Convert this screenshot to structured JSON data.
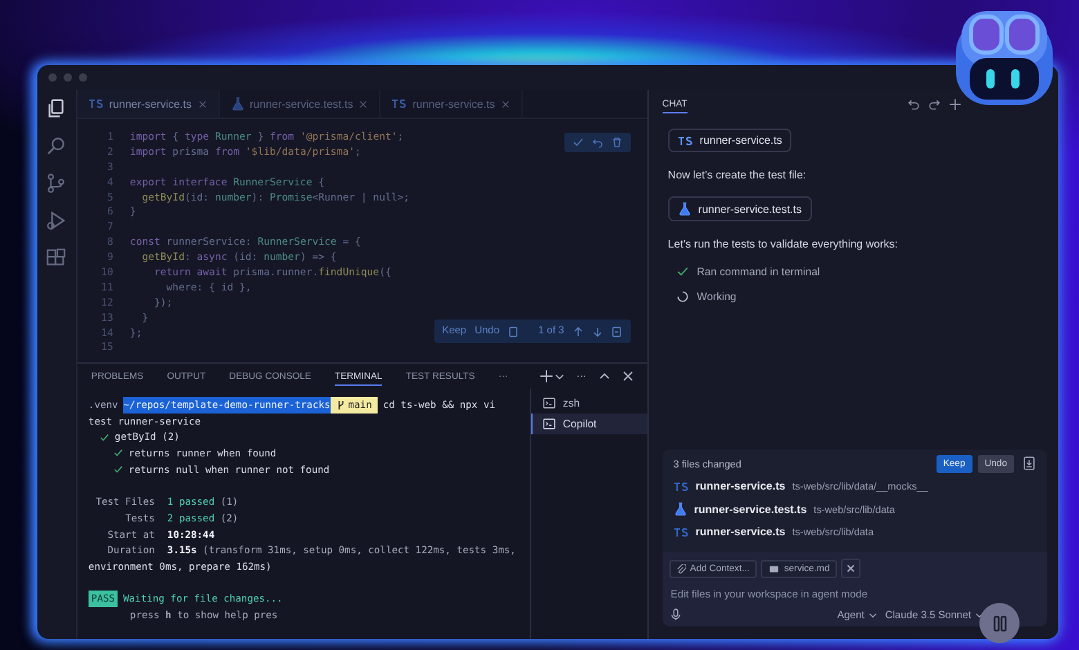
{
  "editor": {
    "tabs": [
      {
        "label": "runner-service.ts",
        "kind": "ts",
        "selected": true
      },
      {
        "label": "runner-service.test.ts",
        "kind": "test",
        "selected": false
      },
      {
        "label": "runner-service.ts",
        "kind": "ts",
        "selected": false
      }
    ],
    "lines": [
      {
        "number": "1",
        "code": [
          {
            "kind": "kw",
            "text": "import"
          },
          {
            "kind": "p",
            "text": " { "
          },
          {
            "kind": "kw",
            "text": "type"
          },
          {
            "kind": "ty",
            "text": " Runner"
          },
          {
            "kind": "p",
            "text": " } "
          },
          {
            "kind": "kw",
            "text": "from"
          },
          {
            "kind": "s",
            "text": " '@prisma/client'"
          },
          {
            "kind": "p",
            "text": ";"
          }
        ]
      },
      {
        "number": "2",
        "code": [
          {
            "kind": "kw",
            "text": "import"
          },
          {
            "kind": "p",
            "text": " prisma "
          },
          {
            "kind": "kw",
            "text": "from"
          },
          {
            "kind": "s",
            "text": " '$lib/data/prisma'"
          },
          {
            "kind": "p",
            "text": ";"
          }
        ]
      },
      {
        "number": "3"
      },
      {
        "number": "4",
        "code": [
          {
            "kind": "kw",
            "text": "export interface"
          },
          {
            "kind": "ty",
            "text": " RunnerService"
          },
          {
            "kind": "p",
            "text": " {"
          }
        ]
      },
      {
        "number": "5",
        "code": [
          {
            "kind": "fn",
            "text": "  getById"
          },
          {
            "kind": "p",
            "text": "(id: "
          },
          {
            "kind": "ty",
            "text": "number"
          },
          {
            "kind": "p",
            "text": "): "
          },
          {
            "kind": "ty",
            "text": "Promise"
          },
          {
            "kind": "p",
            "text": "<Runner | null>;"
          }
        ]
      },
      {
        "number": "6",
        "code": [
          {
            "kind": "p",
            "text": "}"
          }
        ]
      },
      {
        "number": "7"
      },
      {
        "number": "8",
        "code": [
          {
            "kind": "kw",
            "text": "const"
          },
          {
            "kind": "p",
            "text": " runnerService: "
          },
          {
            "kind": "ty",
            "text": "RunnerService"
          },
          {
            "kind": "p",
            "text": " = {"
          }
        ]
      },
      {
        "number": "9",
        "code": [
          {
            "kind": "fn",
            "text": "  getById"
          },
          {
            "kind": "p",
            "text": ": "
          },
          {
            "kind": "kw",
            "text": "async"
          },
          {
            "kind": "p",
            "text": " (id: "
          },
          {
            "kind": "ty",
            "text": "number"
          },
          {
            "kind": "p",
            "text": ") => {"
          }
        ]
      },
      {
        "number": "10",
        "code": [
          {
            "kind": "kw",
            "text": "    return await"
          },
          {
            "kind": "p",
            "text": " prisma.runner."
          },
          {
            "kind": "fn",
            "text": "findUnique"
          },
          {
            "kind": "p",
            "text": "({"
          }
        ]
      },
      {
        "number": "11",
        "code": [
          {
            "kind": "p",
            "text": "      where: { id },"
          }
        ]
      },
      {
        "number": "12",
        "code": [
          {
            "kind": "p",
            "text": "    });"
          }
        ]
      },
      {
        "number": "13",
        "code": [
          {
            "kind": "p",
            "text": "  }"
          }
        ]
      },
      {
        "number": "14",
        "code": [
          {
            "kind": "p",
            "text": "};"
          }
        ]
      },
      {
        "number": "15"
      }
    ],
    "inline_actions": {
      "keep": "Keep",
      "undo": "Undo",
      "counter": "1 of 3"
    }
  },
  "panel": {
    "tabs": [
      {
        "label": "PROBLEMS",
        "selected": false
      },
      {
        "label": "OUTPUT",
        "selected": false
      },
      {
        "label": "DEBUG CONSOLE",
        "selected": false
      },
      {
        "label": "TERMINAL",
        "selected": true
      },
      {
        "label": "TEST RESULTS",
        "selected": false
      }
    ],
    "overflow": "···",
    "more": "···",
    "terminal": [
      {
        "kind": "prompt",
        "spaced": false,
        "venv": ".venv",
        "path": "~/repos/template-demo-runner-tracks",
        "branch": "main",
        "command": "cd ts-web && npx vi"
      },
      {
        "kind": "text",
        "spaced": false,
        "text": "test runner-service"
      },
      {
        "kind": "check",
        "text": "getById (2)",
        "children": [
          {
            "kind": "check",
            "text": "returns runner when found"
          },
          {
            "kind": "check",
            "text": "returns null when runner not found"
          }
        ]
      },
      {
        "kind": "count",
        "spaced": true,
        "label": "Test Files",
        "value": "1 passed",
        "detail": "(1)"
      },
      {
        "kind": "count",
        "spaced": false,
        "label": "Tests",
        "value": "2 passed",
        "detail": "(2)"
      },
      {
        "kind": "time",
        "spaced": false,
        "label": "Start at",
        "value": "10:28:44"
      },
      {
        "kind": "time",
        "spaced": false,
        "label": "Duration",
        "value": "3.15s",
        "detail": "(transform 31ms, setup 0ms, collect 122ms, tests 3ms,"
      },
      {
        "kind": "text",
        "spaced": false,
        "text": "environment 0ms, prepare 162ms)"
      },
      {
        "kind": "status",
        "spaced": true,
        "badge": "PASS",
        "text": "Waiting for file changes..."
      },
      {
        "kind": "hint",
        "spaced": false,
        "text": "press **h** to show help pres"
      }
    ],
    "sessions": [
      {
        "label": "zsh",
        "selected": false
      },
      {
        "label": "Copilot",
        "selected": true
      }
    ]
  },
  "chat": {
    "title": "CHAT",
    "messages": [
      {
        "kind": "file",
        "file": {
          "kind": "ts",
          "text": "runner-service.ts"
        }
      },
      {
        "kind": "text",
        "text": "Now let’s create the test file:"
      },
      {
        "kind": "file",
        "file": {
          "kind": "test",
          "text": "runner-service.test.ts"
        }
      },
      {
        "kind": "text",
        "text": "Let’s run the tests to validate everything works:"
      },
      {
        "kind": "step",
        "done": true,
        "text": "Ran command in terminal"
      },
      {
        "kind": "step",
        "done": false,
        "text": "Working"
      }
    ],
    "changes": {
      "title": "3 files changed",
      "keep": "Keep",
      "undo": "Undo",
      "files": [
        {
          "kind": "ts",
          "name": "runner-service.ts",
          "path": "ts-web/src/lib/data/__mocks__"
        },
        {
          "kind": "test",
          "name": "runner-service.test.ts",
          "path": "ts-web/src/lib/data"
        },
        {
          "kind": "ts",
          "name": "runner-service.ts",
          "path": "ts-web/src/lib/data"
        }
      ]
    },
    "input": {
      "add_context": "Add Context...",
      "attachment": "service.md",
      "placeholder": "Edit files in your workspace in agent mode",
      "mode": "Agent",
      "model": "Claude 3.5 Sonnet"
    }
  }
}
